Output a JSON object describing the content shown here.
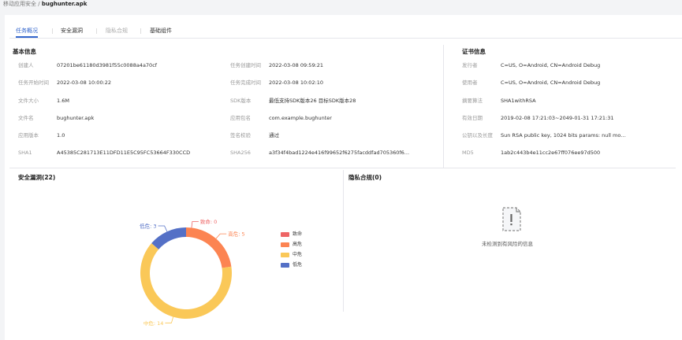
{
  "breadcrumb": {
    "parent": "移动应用安全",
    "sep": "/",
    "current": "bughunter.apk"
  },
  "tabs": [
    {
      "label": "任务概况",
      "state": "active"
    },
    {
      "label": "安全漏洞",
      "state": "normal"
    },
    {
      "label": "隐私合规",
      "state": "disabled"
    },
    {
      "label": "基础组件",
      "state": "normal"
    }
  ],
  "basic_info": {
    "title": "基本信息",
    "rows": [
      {
        "l1": "创建人",
        "v1": "07201be61180d3981f55c0088a4a70cf",
        "l2": "任务创建时间",
        "v2": "2022-03-08 09:59:21"
      },
      {
        "l1": "任务开始时间",
        "v1": "2022-03-08 10:00:22",
        "l2": "任务完成时间",
        "v2": "2022-03-08 10:02:10"
      },
      {
        "l1": "文件大小",
        "v1": "1.6M",
        "l2": "SDK版本",
        "v2": "最低支持SDK版本26 目标SDK版本28"
      },
      {
        "l1": "文件名",
        "v1": "bughunter.apk",
        "l2": "应用包名",
        "v2": "com.example.bughunter"
      },
      {
        "l1": "应用版本",
        "v1": "1.0",
        "l2": "签名校验",
        "v2": "通过"
      },
      {
        "l1": "SHA1",
        "v1": "A45385C281713E11DFD11E5C95FC53664F330CCD",
        "l2": "SHA256",
        "v2": "a3f34f4bad1224e416f99652f6275facddfad705360f6..."
      }
    ]
  },
  "cert_info": {
    "title": "证书信息",
    "rows": [
      {
        "label": "发行者",
        "value": "C=US, O=Android, CN=Android Debug"
      },
      {
        "label": "使用者",
        "value": "C=US, O=Android, CN=Android Debug"
      },
      {
        "label": "摘要算法",
        "value": "SHA1withRSA"
      },
      {
        "label": "有效日期",
        "value": "2019-02-08 17:21:03~2049-01-31 17:21:31"
      },
      {
        "label": "公钥以及长度",
        "value": "Sun RSA public key, 1024 bits params: null modulus: ..."
      },
      {
        "label": "MD5",
        "value": "1ab2c443b4e11cc2e67ff076ee97d500"
      }
    ]
  },
  "vuln": {
    "title": "安全漏洞(22)"
  },
  "privacy": {
    "title": "隐私合规(0)",
    "empty_text": "未检测到有风险的信息"
  },
  "chart_data": {
    "type": "pie",
    "style": "donut",
    "categories": [
      "致命",
      "高危",
      "中危",
      "低危"
    ],
    "values": [
      0,
      5,
      14,
      3
    ],
    "colors": [
      "#ee6666",
      "#fc8452",
      "#fac858",
      "#5470c6"
    ],
    "data_labels": [
      "致命: 0",
      "高危: 5",
      "中危: 14",
      "低危: 3"
    ],
    "legend_position": "right"
  }
}
